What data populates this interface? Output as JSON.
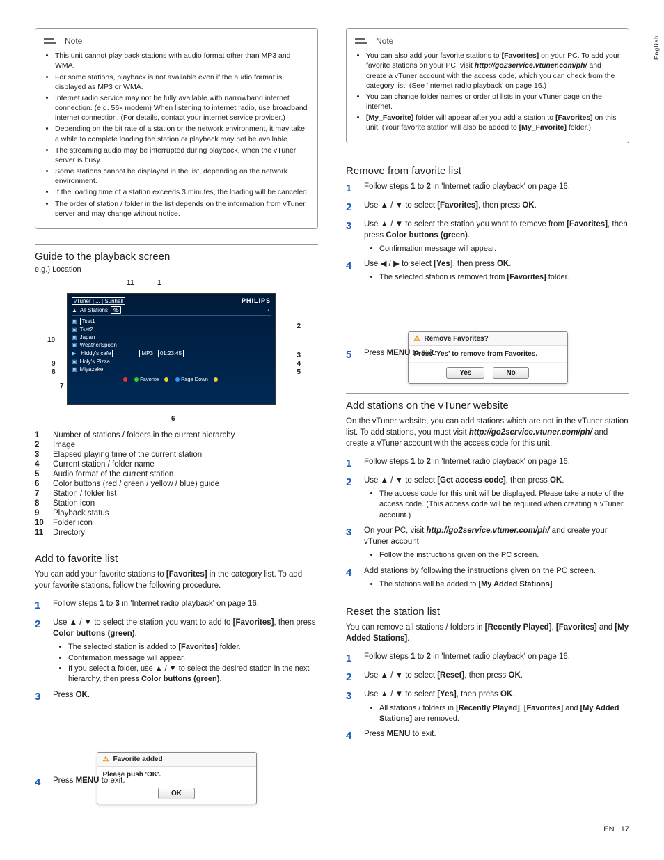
{
  "lang_tab": "English",
  "left": {
    "note_label": "Note",
    "note_bullets": [
      "This unit cannot play back stations with audio format other than MP3 and WMA.",
      "For some stations, playback is not available even if the audio format is displayed as MP3 or WMA.",
      "Internet radio service may not be fully available with narrowband internet connection. (e.g. 56k modem) When listening to internet radio, use broadband internet connection. (For details, contact your internet service provider.)",
      "Depending on the bit rate of a station or the network environment, it may take a while to complete loading the station or playback may not be available.",
      "The streaming audio may be interrupted during playback, when the vTuner server is busy.",
      "Some stations cannot be displayed in the list, depending on the network environment.",
      "If the loading time of a station exceeds 3 minutes, the loading will be canceled.",
      "The order of station / folder in the list depends on the information from vTuner server and may change without notice."
    ],
    "section_guide": "Guide to the playback screen",
    "eg_location": "e.g.) Location",
    "playback": {
      "breadcrumb": "vTuner | ... | Sunhall",
      "brand": "PHILIPS",
      "all_stations": "All Stations",
      "count": "45",
      "rows": [
        "Tset1",
        "Tset2",
        "Japan",
        "WeatherSpoon",
        "Hiddy's cafe",
        "Holy's Pizza",
        "Miyazake"
      ],
      "now_format": "MP3",
      "now_time": "01:23:45",
      "now_title": "Hiddy's cafe",
      "color_green": "Favorite",
      "color_blue": "Page Down",
      "callouts": {
        "1": "1",
        "2": "2",
        "3": "3",
        "4": "4",
        "5": "5",
        "6": "6",
        "7": "7",
        "8": "8",
        "9": "9",
        "10": "10",
        "11": "11"
      }
    },
    "legend": [
      {
        "n": "1",
        "t": "Number of stations / folders in the current hierarchy"
      },
      {
        "n": "2",
        "t": "Image"
      },
      {
        "n": "3",
        "t": "Elapsed playing time of the current station"
      },
      {
        "n": "4",
        "t": "Current station / folder name"
      },
      {
        "n": "5",
        "t": "Audio format of the current station"
      },
      {
        "n": "6",
        "t": "Color buttons (red / green / yellow / blue) guide"
      },
      {
        "n": "7",
        "t": "Station / folder list"
      },
      {
        "n": "8",
        "t": "Station icon"
      },
      {
        "n": "9",
        "t": "Playback status"
      },
      {
        "n": "10",
        "t": "Folder icon"
      },
      {
        "n": "11",
        "t": "Directory"
      }
    ],
    "section_addfav": "Add to favorite list",
    "addfav_intro": "You can add your favorite stations to [Favorites] in the category list. To add your favorite stations, follow the following procedure.",
    "addfav_steps": [
      {
        "n": "1",
        "t": "Follow steps 1 to 3 in 'Internet radio playback' on page 16."
      },
      {
        "n": "2",
        "t": "Use ▲ / ▼ to select the station you want to add to [Favorites], then press Color buttons (green).",
        "subs": [
          "The selected station is added to [Favorites] folder.",
          "Confirmation message will appear.",
          "If you select a folder, use ▲ / ▼ to select the desired station in the next hierarchy, then press Color buttons (green)."
        ]
      },
      {
        "n": "3",
        "t": "Press OK."
      },
      {
        "n": "4",
        "t": "Press MENU to exit."
      }
    ],
    "dialog_fav": {
      "title": "Favorite added",
      "msg": "Please push 'OK'.",
      "ok": "OK"
    }
  },
  "right": {
    "note_label": "Note",
    "note_bullets": [
      "You can also add your favorite stations to [Favorites] on your PC. To add your favorite stations on your PC, visit http://go2service.vtuner.com/ph/ and create a vTuner account with the access code, which you can check from the category list. (See 'Internet radio playback' on page 16.)",
      "You can change folder names or order of lists in your vTuner page on the internet.",
      "[My_Favorite] folder will appear after you add a station to [Favorites] on this unit. (Your favorite station will also be added to [My_Favorite] folder.)"
    ],
    "section_remove": "Remove from favorite list",
    "remove_steps": [
      {
        "n": "1",
        "t": "Follow steps 1 to 2 in 'Internet radio playback' on page 16."
      },
      {
        "n": "2",
        "t": "Use ▲ / ▼ to select [Favorites], then press OK."
      },
      {
        "n": "3",
        "t": "Use ▲ / ▼ to select the station you want to remove from [Favorites], then press Color buttons (green).",
        "subs": [
          "Confirmation message will appear."
        ]
      },
      {
        "n": "4",
        "t": "Use ◀ / ▶ to select [Yes], then press OK.",
        "subs": [
          "The selected station is removed from [Favorites] folder."
        ]
      },
      {
        "n": "5",
        "t": "Press MENU to exit."
      }
    ],
    "dialog_remove": {
      "title": "Remove Favorites?",
      "msg": "Press 'Yes' to remove from Favorites.",
      "yes": "Yes",
      "no": "No"
    },
    "section_addvt": "Add stations on the vTuner website",
    "addvt_intro": "On the vTuner website, you can add stations which are not in the vTuner station list. To add stations, you must visit http://go2service.vtuner.com/ph/ and create a vTuner account with the access code for this unit.",
    "addvt_steps": [
      {
        "n": "1",
        "t": "Follow steps 1 to 2 in 'Internet radio playback' on page 16."
      },
      {
        "n": "2",
        "t": "Use ▲ / ▼ to select [Get access code], then press OK.",
        "subs": [
          "The access code for this unit will be displayed. Please take a note of the access code. (This access code will be required when creating a vTuner account.)"
        ]
      },
      {
        "n": "3",
        "t": "On your PC, visit http://go2service.vtuner.com/ph/ and create your vTuner account.",
        "subs": [
          "Follow the instructions given on the PC screen."
        ]
      },
      {
        "n": "4",
        "t": "Add stations by following the instructions given on the PC screen.",
        "subs": [
          "The stations will be added to [My Added Stations]."
        ]
      }
    ],
    "section_reset": "Reset the station list",
    "reset_intro": "You can remove all stations / folders in [Recently Played], [Favorites] and [My Added Stations].",
    "reset_steps": [
      {
        "n": "1",
        "t": "Follow steps 1 to 2 in 'Internet radio playback' on page 16."
      },
      {
        "n": "2",
        "t": "Use ▲ / ▼ to select [Reset], then press OK."
      },
      {
        "n": "3",
        "t": "Use ▲ / ▼ to select [Yes], then press OK.",
        "subs": [
          "All stations / folders in [Recently Played], [Favorites]  and [My Added Stations] are removed."
        ]
      },
      {
        "n": "4",
        "t": "Press MENU to exit."
      }
    ]
  },
  "footer": {
    "lang": "EN",
    "page": "17"
  }
}
